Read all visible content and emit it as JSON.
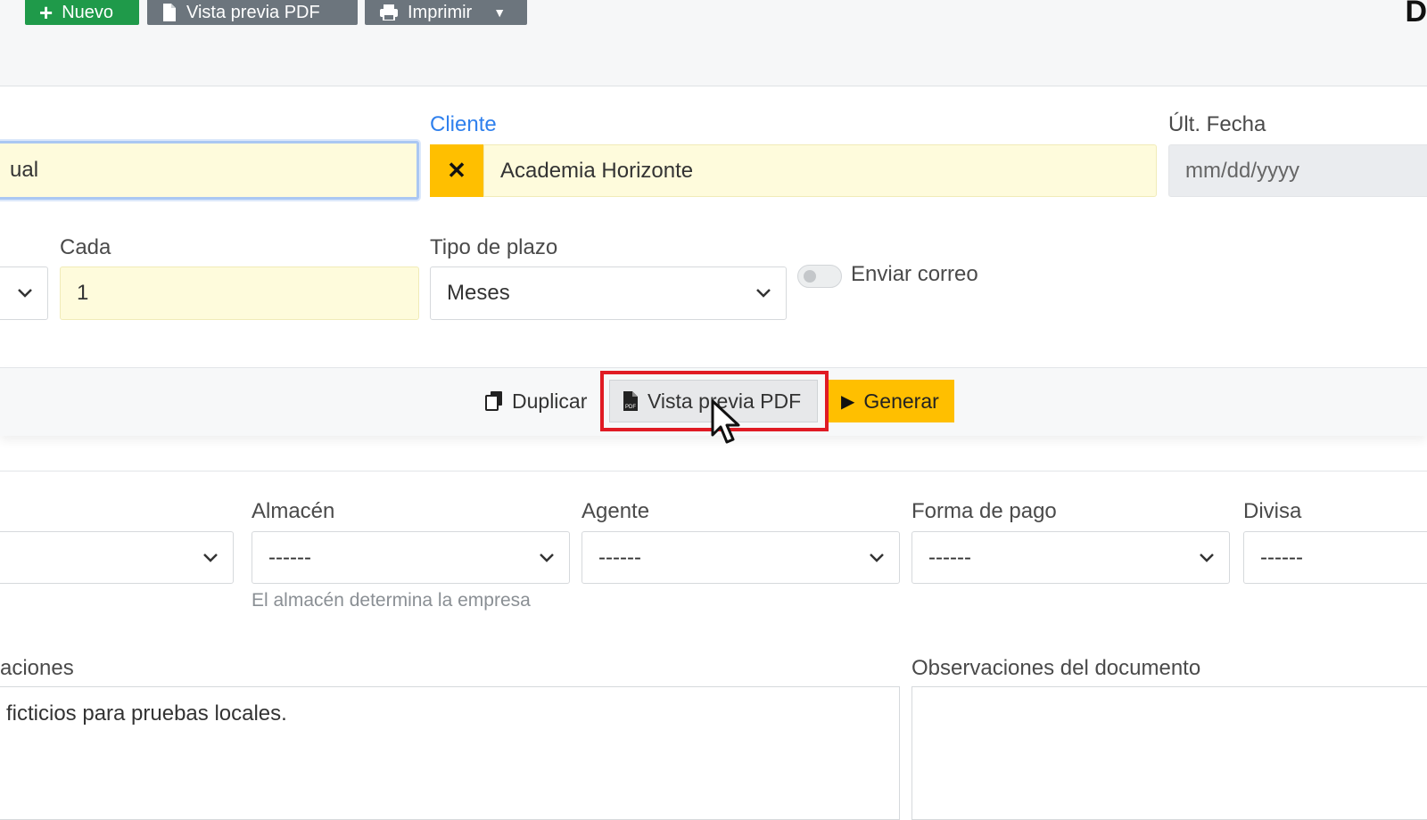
{
  "toolbar": {
    "new_label": "Nuevo",
    "pdf_preview_label": "Vista previa PDF",
    "print_label": "Imprimir",
    "heading_partial": "D"
  },
  "form": {
    "name_value_partial": "ual",
    "client": {
      "label": "Cliente",
      "value": "Academia Horizonte"
    },
    "last_date": {
      "label": "Últ. Fecha",
      "placeholder": "mm/dd/yyyy"
    },
    "cada": {
      "label": "Cada",
      "value": "1"
    },
    "tipo_plazo": {
      "label": "Tipo de plazo",
      "value": "Meses"
    },
    "send_email": {
      "label": "Enviar correo",
      "on": false
    }
  },
  "actions": {
    "duplicate_label": "Duplicar",
    "pdf_preview_label": "Vista previa PDF",
    "generate_label": "Generar"
  },
  "details": {
    "almacen": {
      "label": "Almacén",
      "value": "------",
      "help": "El almacén determina la empresa"
    },
    "agente": {
      "label": "Agente",
      "value": "------"
    },
    "forma_pago": {
      "label": "Forma de pago",
      "value": "------"
    },
    "divisa": {
      "label": "Divisa",
      "value": "------"
    }
  },
  "notes": {
    "left_label_partial": "aciones",
    "left_value_partial": "ficticios para pruebas locales.",
    "right_label": "Observaciones del documento",
    "right_value": ""
  },
  "colors": {
    "green": "#1f9a4a",
    "gray_button": "#6c757d",
    "accent_yellow": "#ffbf00",
    "field_yellow": "#fefbdc",
    "link_blue": "#2f80ed",
    "highlight_red": "#e01b24"
  }
}
